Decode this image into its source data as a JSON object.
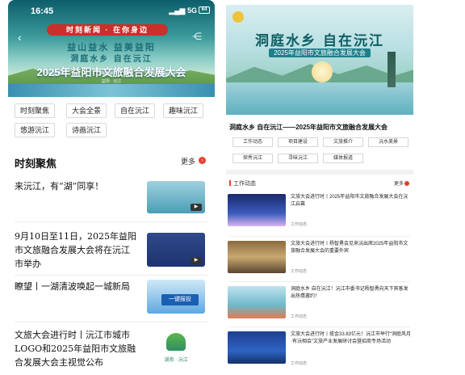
{
  "left": {
    "status": {
      "time": "16:45",
      "network": "5G",
      "battery": "64"
    },
    "hero": {
      "ribbon": "时刻新闻 · 在你身边",
      "slogan_line1": "益山益水 益美益阳",
      "slogan_line2": "洞庭水乡 自在沅江",
      "title": "2025年益阳市文旅融合发展大会",
      "footnote": "益阳 · 沅江"
    },
    "tags": [
      "时刻聚焦",
      "大会全景",
      "自在沅江",
      "趣味沅江",
      "悠游沅江",
      "诗画沅江"
    ],
    "section": {
      "title": "时刻聚焦",
      "more": "更多"
    },
    "news": [
      {
        "title": "来沅江，有“湖”同享！"
      },
      {
        "title": "9月10日至11日，2025年益阳市文旅融合发展大会将在沅江市举办"
      },
      {
        "title": "瞭望丨一湖清波唤起一城新局",
        "thumb_text": "一键报投"
      },
      {
        "title": "文旅大会进行时丨沅江市城市LOGO和2025年益阳市文旅融合发展大会主视觉公布",
        "thumb_text": "湖南 · 沅江"
      }
    ]
  },
  "right": {
    "hero": {
      "title": "洞庭水乡 自在沅江",
      "subtitle": "2025年益阳市文旅融合发展大会"
    },
    "headline": "洞庭水乡 自在沅江——2025年益阳市文旅融合发展大会",
    "tags": [
      "工作动态",
      "项目建设",
      "文旅推介",
      "沅水美景",
      "探秀沅江",
      "寻味沅江",
      "媒体报道"
    ],
    "section": {
      "title": "工作动态",
      "more": "更多"
    },
    "items": [
      {
        "title": "文旅大会进行时丨2025年益阳市文旅融合发展大会在沅江启幕",
        "source": "工作动态"
      },
      {
        "title": "文旅大会进行时丨杨智勇会见来沅出席2025年益阳市文旅融合发展大会的重要外宾",
        "source": "工作动态"
      },
      {
        "title": "洞庭水乡 自在沅江！沅江市委书记杨智勇向天下宾客发出热情邀约！",
        "source": "工作动态"
      },
      {
        "title": "文旅大会进行时丨揽金33.83亿元！沅江市举行“洞庭风月·有沅相会”文旅产业发展研讨会暨招商专场活动",
        "source": "工作动态"
      }
    ]
  },
  "colors": {
    "accent_red": "#e5402f",
    "brand_teal": "#1c6f77"
  }
}
